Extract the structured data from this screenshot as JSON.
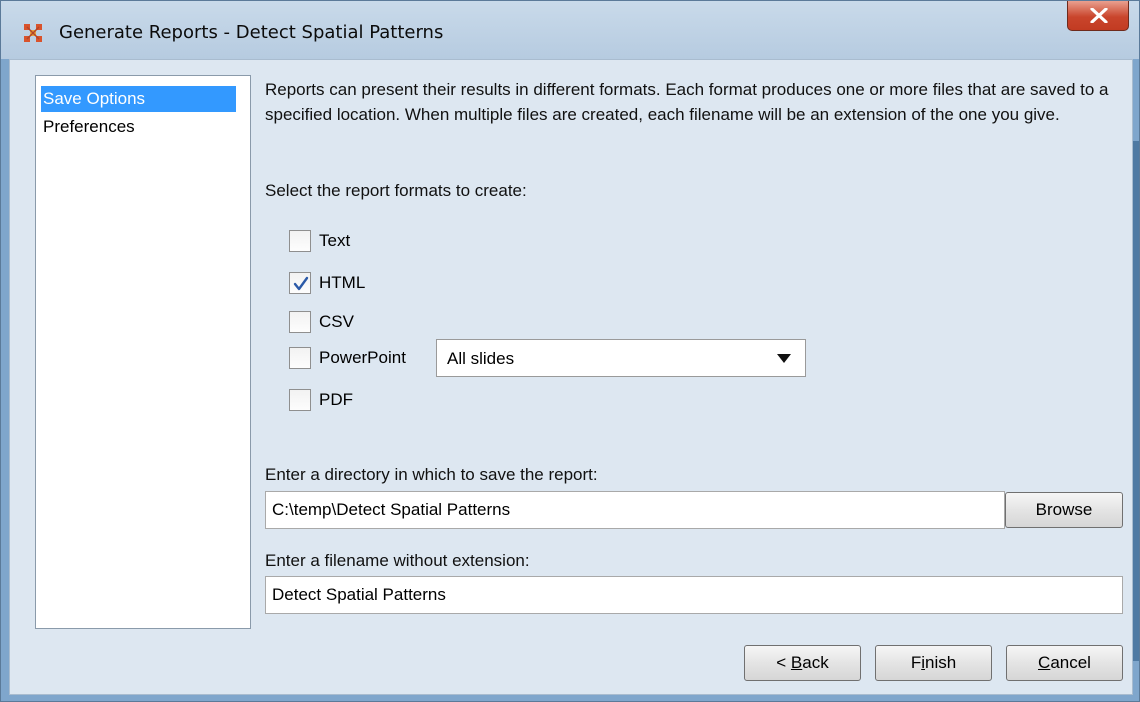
{
  "window": {
    "title": "Generate Reports - Detect Spatial Patterns",
    "icon": "network-grid-icon",
    "close_icon": "close-x-icon"
  },
  "sidebar": {
    "items": [
      {
        "label": "Save Options",
        "selected": true
      },
      {
        "label": "Preferences",
        "selected": false
      }
    ]
  },
  "main": {
    "description": "Reports can present their results in different formats. Each format produces one or more files that are saved to a specified location. When multiple files are created, each filename will be an extension of the one you give.",
    "formats_prompt": "Select the report formats to create:",
    "formats": [
      {
        "label": "Text",
        "checked": false
      },
      {
        "label": "HTML",
        "checked": true
      },
      {
        "label": "CSV",
        "checked": false
      },
      {
        "label": "PowerPoint",
        "checked": false
      },
      {
        "label": "PDF",
        "checked": false
      }
    ],
    "powerpoint_select": {
      "value": "All slides"
    },
    "directory_prompt": "Enter a directory in which to save the report:",
    "directory_value": "C:\\temp\\Detect Spatial Patterns",
    "browse_label": "Browse",
    "filename_prompt": "Enter a filename without extension:",
    "filename_value": "Detect Spatial Patterns"
  },
  "footer": {
    "back": {
      "prefix": "< ",
      "mnemonic": "B",
      "rest": "ack"
    },
    "finish": {
      "prefix": "F",
      "mnemonic": "i",
      "rest": "nish"
    },
    "cancel": {
      "prefix": "",
      "mnemonic": "C",
      "rest": "ancel"
    }
  },
  "colors": {
    "selection": "#3399ff",
    "client_background": "#dde7f1",
    "close_button": "#c9452c"
  }
}
